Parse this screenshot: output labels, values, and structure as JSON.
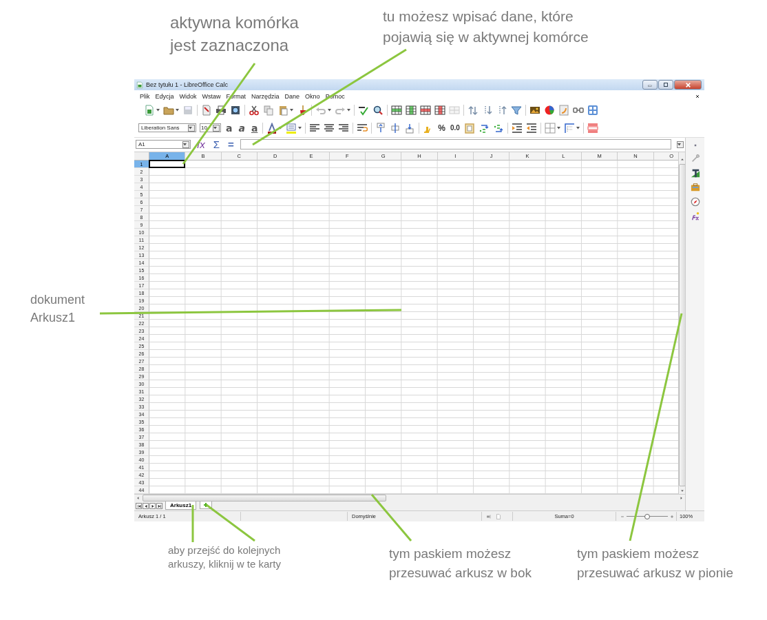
{
  "annotations": [
    {
      "kind": "large",
      "lines": [
        "aktywna komórka",
        "jest zaznaczona"
      ]
    },
    {
      "kind": "medium",
      "lines": [
        "tu możesz wpisać dane, które",
        "pojawią się w aktywnej komórce"
      ]
    },
    {
      "kind": "left",
      "lines": [
        "dokument",
        "Arkusz1"
      ]
    },
    {
      "kind": "small",
      "lines": [
        "aby przejść do kolejnych",
        "arkuszy, kliknij w te karty"
      ]
    },
    {
      "kind": "medium2",
      "lines": [
        "tym paskiem możesz",
        "przesuwać arkusz w bok"
      ]
    },
    {
      "kind": "medium3",
      "lines": [
        "tym paskiem możesz",
        "przesuwać arkusz w pionie"
      ]
    }
  ],
  "window": {
    "title": "Bez tytułu 1 - LibreOffice Calc"
  },
  "menu": [
    "Plik",
    "Edycja",
    "Widok",
    "Wstaw",
    "Format",
    "Narzędzia",
    "Dane",
    "Okno",
    "Pomoc"
  ],
  "toolbar": {
    "font_name": "Liberation Sans",
    "font_size": "10",
    "format_glyphs": [
      {
        "kind": "bold",
        "text": "a"
      },
      {
        "kind": "italic",
        "text": "a"
      },
      {
        "kind": "underline",
        "text": "a"
      }
    ],
    "number_formats": [
      {
        "kind": "percent",
        "text": "%"
      },
      {
        "kind": "decimal",
        "text": "0.0"
      }
    ]
  },
  "formula_bar": {
    "cell_ref": "A1",
    "buttons": [
      {
        "kind": "wizard",
        "text": "fx"
      },
      {
        "kind": "sum",
        "text": "Σ"
      },
      {
        "kind": "equals",
        "text": "="
      }
    ]
  },
  "columns": [
    {
      "label": "A",
      "selected": true
    },
    {
      "label": "B",
      "selected": false
    },
    {
      "label": "C",
      "selected": false
    },
    {
      "label": "D",
      "selected": false
    },
    {
      "label": "E",
      "selected": false
    },
    {
      "label": "F",
      "selected": false
    },
    {
      "label": "G",
      "selected": false
    },
    {
      "label": "H",
      "selected": false
    },
    {
      "label": "I",
      "selected": false
    },
    {
      "label": "J",
      "selected": false
    },
    {
      "label": "K",
      "selected": false
    },
    {
      "label": "L",
      "selected": false
    },
    {
      "label": "M",
      "selected": false
    },
    {
      "label": "N",
      "selected": false
    },
    {
      "label": "O",
      "selected": false
    }
  ],
  "rows": [
    {
      "label": "1",
      "selected": true
    },
    {
      "label": "2",
      "selected": false
    },
    {
      "label": "3",
      "selected": false
    },
    {
      "label": "4",
      "selected": false
    },
    {
      "label": "5",
      "selected": false
    },
    {
      "label": "6",
      "selected": false
    },
    {
      "label": "7",
      "selected": false
    },
    {
      "label": "8",
      "selected": false
    },
    {
      "label": "9",
      "selected": false
    },
    {
      "label": "10",
      "selected": false
    },
    {
      "label": "11",
      "selected": false
    },
    {
      "label": "12",
      "selected": false
    },
    {
      "label": "13",
      "selected": false
    },
    {
      "label": "14",
      "selected": false
    },
    {
      "label": "15",
      "selected": false
    },
    {
      "label": "16",
      "selected": false
    },
    {
      "label": "17",
      "selected": false
    },
    {
      "label": "18",
      "selected": false
    },
    {
      "label": "19",
      "selected": false
    },
    {
      "label": "20",
      "selected": false
    },
    {
      "label": "21",
      "selected": false
    },
    {
      "label": "22",
      "selected": false
    },
    {
      "label": "23",
      "selected": false
    },
    {
      "label": "24",
      "selected": false
    },
    {
      "label": "25",
      "selected": false
    },
    {
      "label": "26",
      "selected": false
    },
    {
      "label": "27",
      "selected": false
    },
    {
      "label": "28",
      "selected": false
    },
    {
      "label": "29",
      "selected": false
    },
    {
      "label": "30",
      "selected": false
    },
    {
      "label": "31",
      "selected": false
    },
    {
      "label": "32",
      "selected": false
    },
    {
      "label": "33",
      "selected": false
    },
    {
      "label": "34",
      "selected": false
    },
    {
      "label": "35",
      "selected": false
    },
    {
      "label": "36",
      "selected": false
    },
    {
      "label": "37",
      "selected": false
    },
    {
      "label": "38",
      "selected": false
    },
    {
      "label": "39",
      "selected": false
    },
    {
      "label": "40",
      "selected": false
    },
    {
      "label": "41",
      "selected": false
    },
    {
      "label": "42",
      "selected": false
    },
    {
      "label": "43",
      "selected": false
    },
    {
      "label": "44",
      "selected": false
    }
  ],
  "sheet_tabs": [
    {
      "label": "Arkusz1",
      "selected": true
    }
  ],
  "status_bar": {
    "sheet": "Arkusz 1 / 1",
    "style": "Domyślnie",
    "sum": "Suma=0",
    "zoom": {
      "level": 0.5
    },
    "zoom_percent": "100%"
  }
}
